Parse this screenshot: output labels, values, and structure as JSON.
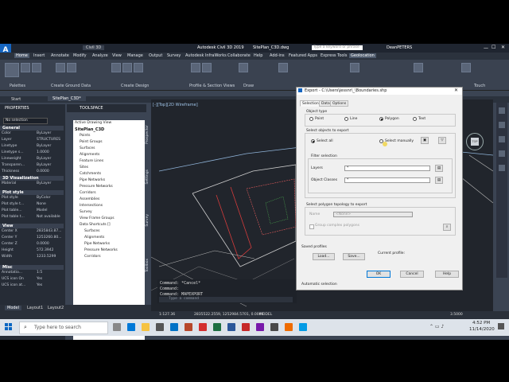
{
  "window": {
    "app_title": "Autodesk Civil 3D 2019",
    "file_title": "SitePlan_C3D.dwg",
    "workspace": "Civil 3D",
    "search_placeholder": "Type a keyword or phrase",
    "user": "DeanPETERS"
  },
  "menu_tabs": [
    "Home",
    "Insert",
    "Annotate",
    "Modify",
    "Analyze",
    "View",
    "Manage",
    "Output",
    "Survey",
    "Autodesk InfraWorks",
    "Collaborate",
    "Help",
    "Add-ins",
    "Featured Apps",
    "Express Tools",
    "Geolocation"
  ],
  "ribbon_groups": [
    "Palettes",
    "Create Ground Data",
    "Create Design",
    "Profile & Section Views",
    "Draw",
    "Touch"
  ],
  "doc_tabs": [
    "Start",
    "SitePlan_C3D*"
  ],
  "properties": {
    "title": "PROPERTIES",
    "selection": "No selection",
    "general_head": "General",
    "rows": [
      {
        "k": "Color",
        "v": "ByLayer"
      },
      {
        "k": "Layer",
        "v": "STRUCTURES"
      },
      {
        "k": "Linetype",
        "v": "ByLayer"
      },
      {
        "k": "Linetype s...",
        "v": "1.0000"
      },
      {
        "k": "Lineweight",
        "v": "ByLayer"
      },
      {
        "k": "Transparen...",
        "v": "ByLayer"
      },
      {
        "k": "Thickness",
        "v": "0.0000"
      }
    ],
    "viz_head": "3D Visualization",
    "viz_rows": [
      {
        "k": "Material",
        "v": "ByLayer"
      }
    ],
    "plot_head": "Plot style",
    "plot_rows": [
      {
        "k": "Plot style",
        "v": "ByColor"
      },
      {
        "k": "Plot style t...",
        "v": "None"
      },
      {
        "k": "Plot table...",
        "v": "Model"
      },
      {
        "k": "Plot table t...",
        "v": "Not available"
      }
    ],
    "view_head": "View",
    "view_rows": [
      {
        "k": "Center X",
        "v": "2835843.87..."
      },
      {
        "k": "Center Y",
        "v": "1253260.80..."
      },
      {
        "k": "Center Z",
        "v": "0.0000"
      },
      {
        "k": "Height",
        "v": "572.3942"
      },
      {
        "k": "Width",
        "v": "1233.5299"
      }
    ],
    "misc_head": "Misc",
    "misc_rows": [
      {
        "k": "Annotatio...",
        "v": "1:5"
      },
      {
        "k": "UCS icon On",
        "v": "Yes"
      },
      {
        "k": "UCS icon at...",
        "v": "Yes"
      }
    ]
  },
  "toolspace": {
    "title": "TOOLSPACE",
    "view_label": "Active Drawing View",
    "root": "SitePlan_C3D",
    "items": [
      "Points",
      "Point Groups",
      "Surfaces",
      "Alignments",
      "Feature Lines",
      "Sites",
      "Catchments",
      "Pipe Networks",
      "Pressure Networks",
      "Corridors",
      "Assemblies",
      "Intersections",
      "Survey",
      "View Frame Groups",
      "Data Shortcuts []",
      "Surfaces",
      "Alignments",
      "Pipe Networks",
      "Pressure Networks",
      "Corridors"
    ],
    "side_tabs": [
      "Prospector",
      "Settings",
      "Survey",
      "Toolbox"
    ]
  },
  "viewport_label": "[-][Top][2D Wireframe]",
  "command": {
    "lines": [
      "Command: *Cancel*",
      "Command:",
      "Command: MAPEXPORT"
    ],
    "input_placeholder": "Type a command"
  },
  "layout_tabs": [
    "Model",
    "Layout1",
    "Layout2"
  ],
  "status": {
    "scale": "1:127.36",
    "coords": "2835522.2559, 1252984.5701, 0.0000",
    "mode": "MODEL",
    "zoom": "3.5000"
  },
  "dialog": {
    "title": "Export - C:\\Users\\jessnr\\_\\Boundaries.shp",
    "tabs": [
      "Selection",
      "Data",
      "Options"
    ],
    "object_type_label": "Object type",
    "object_types": [
      "Point",
      "Line",
      "Polygon",
      "Text"
    ],
    "selected_type": "Polygon",
    "select_objects_label": "Select objects to export",
    "select_all": "Select all",
    "select_manually": "Select manually",
    "filter_label": "Filter selection",
    "layers_label": "Layers",
    "layers_value": "*",
    "classes_label": "Object Classes",
    "classes_value": "*",
    "topology_label": "Select polygon topology to export",
    "name_label": "Name",
    "name_value": "<None>",
    "group_label": "Group complex polygons",
    "saved_profiles_label": "Saved profiles",
    "current_profile_label": "Current profile:",
    "load_label": "Load...",
    "save_label": "Save...",
    "ok_label": "OK",
    "cancel_label": "Cancel",
    "help_label": "Help",
    "footer": "Automatic selection"
  },
  "taskbar": {
    "search_placeholder": "Type here to search",
    "time": "4:52 PM",
    "date": "11/14/2020"
  },
  "colors": {
    "accent_red": "#c62828",
    "autocad_blue": "#1565c0",
    "drawing_bg": "#21252c"
  }
}
